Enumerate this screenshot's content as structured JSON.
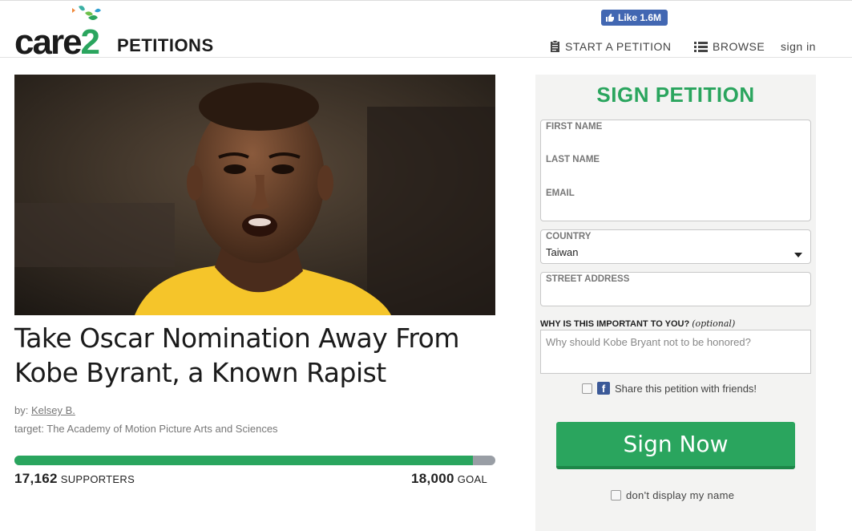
{
  "logo": {
    "brand_a": "care",
    "brand_b": "2",
    "product": "PETITIONS"
  },
  "header": {
    "fb_like": "Like 1.6M",
    "nav": {
      "start": "START A PETITION",
      "browse": "BROWSE",
      "signin": "sign in"
    }
  },
  "petition": {
    "title": "Take Oscar Nomination Away From Kobe Byrant, a Known Rapist",
    "by_prefix": "by:",
    "author": "Kelsey B.",
    "target_prefix": "target:",
    "target": "The Academy of Motion Picture Arts and Sciences",
    "supporters": "17,162",
    "supporters_label": "SUPPORTERS",
    "goal": "18,000",
    "goal_label": "GOAL",
    "progress": 0.9535
  },
  "form": {
    "title": "SIGN PETITION",
    "first_name_label": "FIRST NAME",
    "last_name_label": "LAST NAME",
    "email_label": "EMAIL",
    "country_label": "COUNTRY",
    "country_value": "Taiwan",
    "street_label": "STREET ADDRESS",
    "why_label": "WHY IS THIS IMPORTANT TO YOU?",
    "why_optional": "(optional)",
    "why_placeholder": "Why should Kobe Bryant not to be honored?",
    "share_label": "Share this petition with friends!",
    "sign_button": "Sign Now",
    "hide_name_label": "don't display my name"
  },
  "colors": {
    "accent": "#2aa55e",
    "facebook": "#4267b2",
    "progress_track": "#999ea5"
  }
}
